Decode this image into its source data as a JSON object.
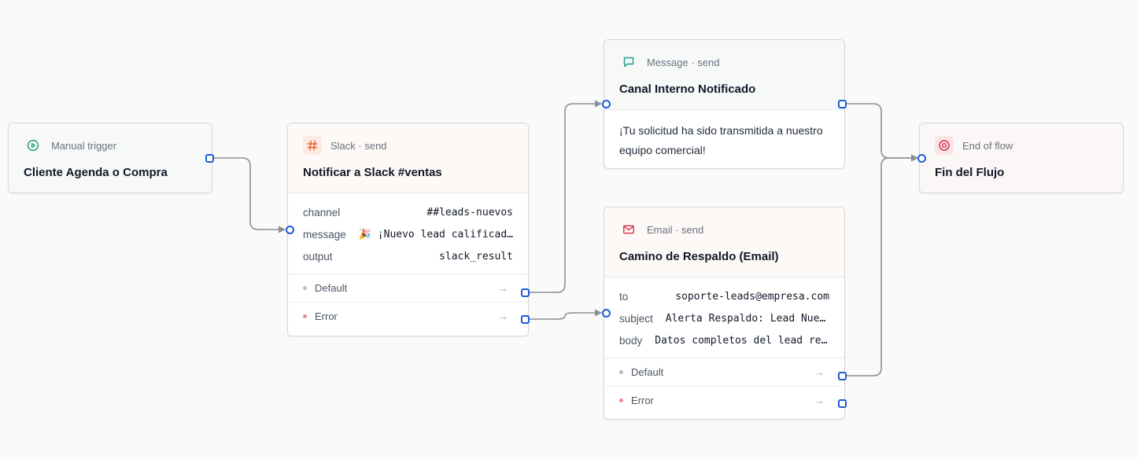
{
  "nodes": {
    "trigger": {
      "type_label": "Manual trigger",
      "title": "Cliente Agenda o Compra",
      "icon": "play-circle-icon"
    },
    "slack": {
      "type_label": "Slack · send",
      "title": "Notificar a Slack #ventas",
      "icon": "hash-icon",
      "params": [
        {
          "key": "channel",
          "value": "##leads-nuevos"
        },
        {
          "key": "message",
          "value": "🎉 ¡Nuevo lead calificado!"
        },
        {
          "key": "output",
          "value": "slack_result"
        }
      ],
      "outputs": [
        {
          "label": "Default",
          "arrow": "→"
        },
        {
          "label": "Error",
          "arrow": "→"
        }
      ]
    },
    "message": {
      "type_label": "Message · send",
      "title": "Canal Interno Notificado",
      "icon": "chat-bubble-icon",
      "body": "¡Tu solicitud ha sido transmitida a nuestro equipo comercial!"
    },
    "email": {
      "type_label": "Email · send",
      "title": "Camino de Respaldo (Email)",
      "icon": "envelope-icon",
      "params": [
        {
          "key": "to",
          "value": "soporte-leads@empresa.com"
        },
        {
          "key": "subject",
          "value": "Alerta Respaldo: Lead Nuevo"
        },
        {
          "key": "body",
          "value": "Datos completos del lead recibido"
        }
      ],
      "outputs": [
        {
          "label": "Default",
          "arrow": "→"
        },
        {
          "label": "Error",
          "arrow": "→"
        }
      ]
    },
    "end": {
      "type_label": "End of flow",
      "title": "Fin del Flujo",
      "icon": "stop-circle-icon"
    }
  },
  "colors": {
    "handle": "#1e5bd8",
    "edge": "#8a8f98",
    "trigger_icon": "#1f9d72",
    "slack_icon": "#e0613a",
    "message_icon": "#1f9d8f",
    "email_icon": "#d3304a",
    "end_icon": "#d3304a",
    "default_dot": "#b8bcc3",
    "error_dot": "#f08b8b"
  }
}
